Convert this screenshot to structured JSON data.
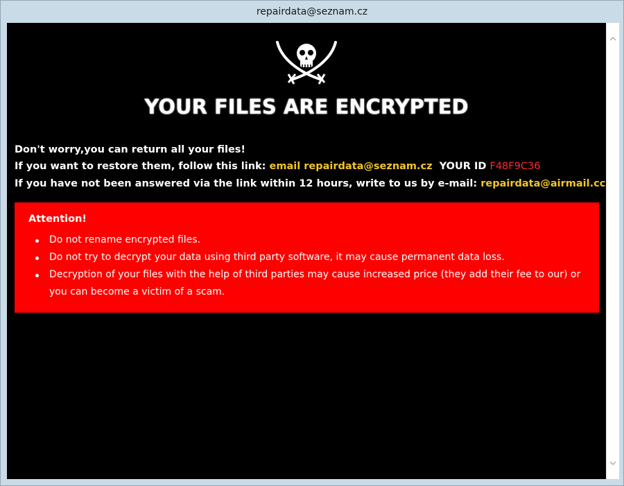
{
  "window": {
    "title": "repairdata@seznam.cz"
  },
  "logo": {
    "icon": "jolly-roger-skull-crossed-swords-icon"
  },
  "headline": "YOUR FILES ARE ENCRYPTED",
  "message": {
    "line1": "Don't worry,you can return all your files!",
    "line2_prefix": "If you want to restore them, follow this link:",
    "line2_email": "email repairdata@seznam.cz",
    "line2_id_label": "YOUR ID",
    "line2_id_value": "F48F9C36",
    "line3_prefix": "If you have not been answered via the link within 12 hours, write to us by e-mail:",
    "line3_email": "repairdata@airmail.cc"
  },
  "attention": {
    "title": "Attention!",
    "items": [
      "Do not rename encrypted files.",
      "Do not try to decrypt your data using third party software, it may cause permanent data loss.",
      "Decryption of your files with the help of third parties may cause increased price (they add their fee to our) or you can become a victim of a scam."
    ]
  },
  "colors": {
    "background": "#000000",
    "accent_yellow": "#f3c623",
    "id_red": "#ff2a2a",
    "attention_bg": "#ff0000",
    "window_frame": "#c9dbe6"
  },
  "scrollbar": {
    "up_icon": "chevron-up-icon",
    "down_icon": "chevron-down-icon"
  }
}
